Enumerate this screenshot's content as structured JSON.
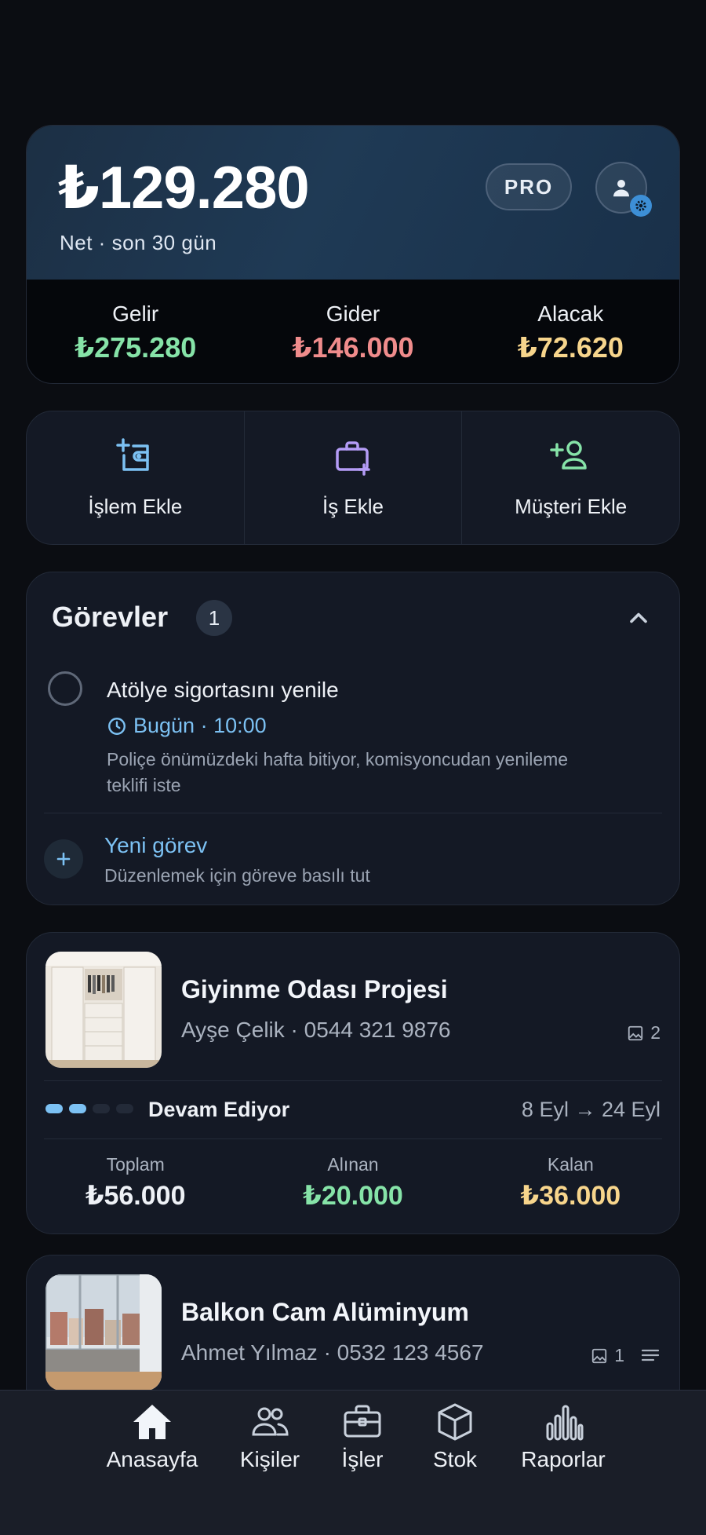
{
  "summary": {
    "net_amount": "₺129.280",
    "net_label": "Net · son 30 gün",
    "pro_label": "PRO",
    "stats": [
      {
        "label": "Gelir",
        "value": "₺275.280",
        "color": "#86e3a8"
      },
      {
        "label": "Gider",
        "value": "₺146.000",
        "color": "#f08c8c"
      },
      {
        "label": "Alacak",
        "value": "₺72.620",
        "color": "#f7d58c"
      }
    ]
  },
  "quick_actions": [
    {
      "label": "İşlem Ekle",
      "icon": "add-transaction-icon",
      "color": "#7cc1f3"
    },
    {
      "label": "İş Ekle",
      "icon": "add-job-icon",
      "color": "#b49cf6"
    },
    {
      "label": "Müşteri Ekle",
      "icon": "add-customer-icon",
      "color": "#86e3a8"
    }
  ],
  "tasks": {
    "title": "Görevler",
    "count": "1",
    "items": [
      {
        "title": "Atölye sigortasını yenile",
        "time": "Bugün · 10:00",
        "description": "Poliçe önümüzdeki hafta bitiyor, komisyoncudan yenileme teklifi iste"
      }
    ],
    "new_label": "Yeni görev",
    "new_hint": "Düzenlemek için göreve basılı tut"
  },
  "projects": [
    {
      "title": "Giyinme Odası Projesi",
      "customer": "Ayşe Çelik",
      "phone": "· 0544 321 9876",
      "image_count": "2",
      "status": "Devam Ediyor",
      "progress_steps_done": 2,
      "progress_steps_total": 4,
      "date_range": "8 Eyl → 24 Eyl",
      "totals": [
        {
          "label": "Toplam",
          "value": "₺56.000",
          "color": "#eef1f6"
        },
        {
          "label": "Alınan",
          "value": "₺20.000",
          "color": "#86e3a8"
        },
        {
          "label": "Kalan",
          "value": "₺36.000",
          "color": "#f7d58c"
        }
      ]
    },
    {
      "title": "Balkon Cam Alüminyum",
      "customer": "Ahmet Yılmaz",
      "phone": "· 0532 123 4567",
      "image_count": "1"
    }
  ],
  "bottom_nav": [
    {
      "label": "Anasayfa",
      "icon": "home-icon",
      "active": true
    },
    {
      "label": "Kişiler",
      "icon": "people-icon"
    },
    {
      "label": "İşler",
      "icon": "briefcase-icon"
    },
    {
      "label": "Stok",
      "icon": "box-icon"
    },
    {
      "label": "Raporlar",
      "icon": "chart-icon"
    }
  ]
}
